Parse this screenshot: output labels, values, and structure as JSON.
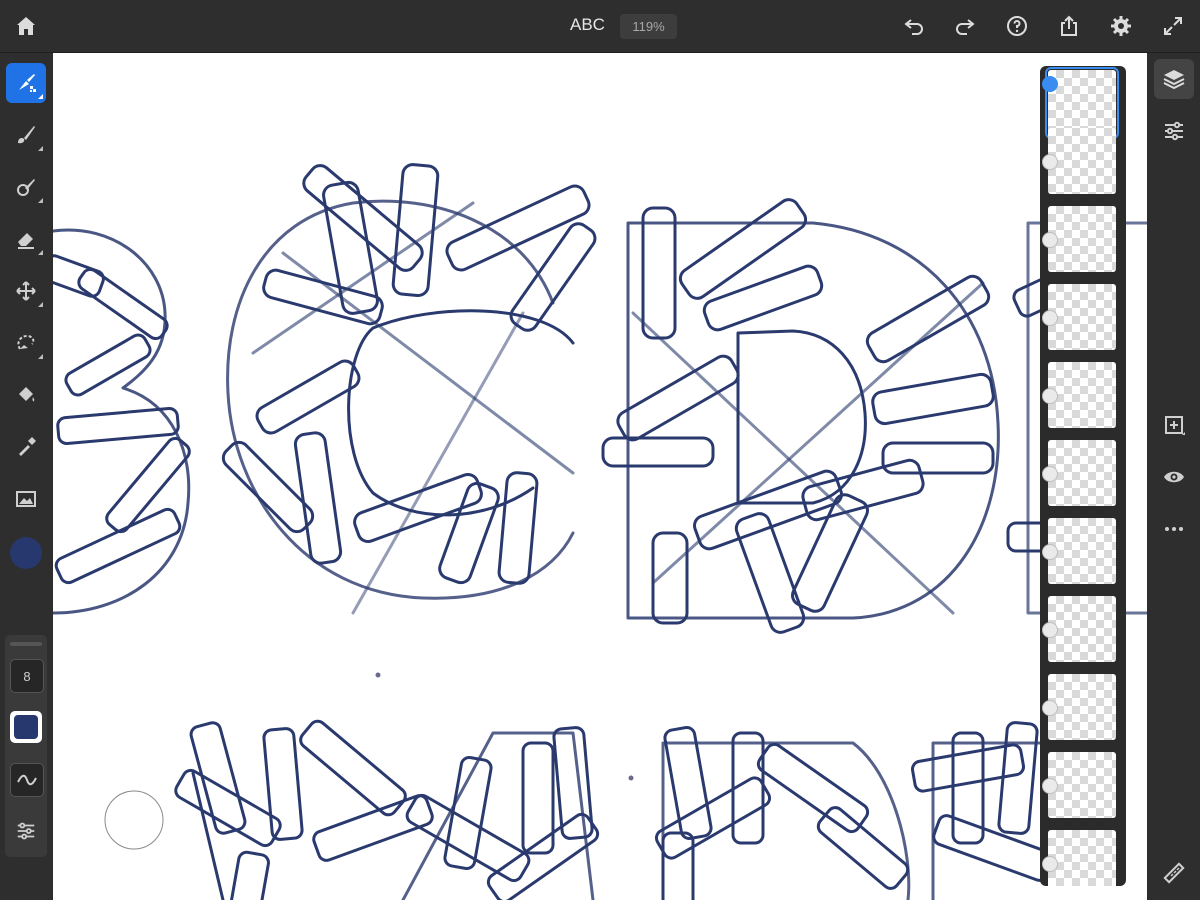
{
  "header": {
    "title": "ABC",
    "zoom": "119%",
    "icons": [
      "home-icon",
      "undo-icon",
      "redo-icon",
      "help-icon",
      "share-icon",
      "settings-icon",
      "fullscreen-icon"
    ]
  },
  "left_toolbar": {
    "tools": [
      "pixel-brush-icon",
      "live-brush-icon",
      "vector-brush-icon",
      "eraser-icon",
      "move-icon",
      "lasso-icon",
      "fill-icon",
      "eyedropper-icon",
      "image-icon"
    ],
    "active_tool": "pixel-brush-icon",
    "brush_size": "8",
    "color": "#27386e"
  },
  "right_toolbar": {
    "icons": [
      "layers-icon",
      "layer-properties-icon",
      "add-layer-icon",
      "visibility-icon",
      "more-icon",
      "ruler-icon"
    ]
  },
  "layers": {
    "count": 11,
    "selected_index": 0
  },
  "canvas": {
    "stroke_color": "#2a3a6e"
  }
}
